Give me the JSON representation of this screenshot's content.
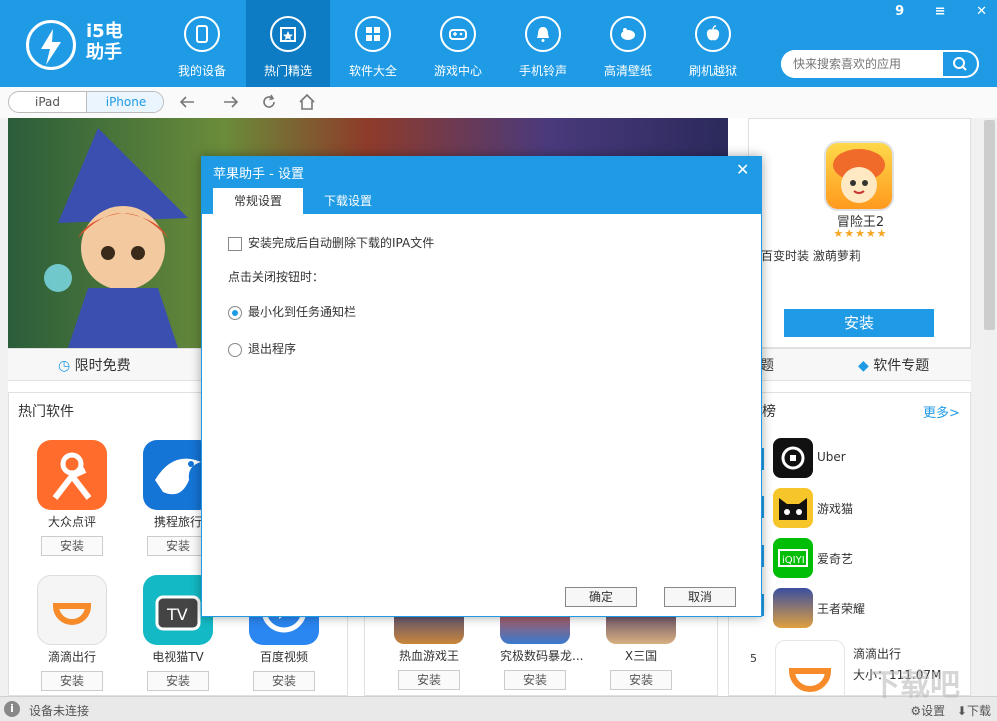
{
  "app": {
    "brand": "i5电\n助手"
  },
  "nav": [
    {
      "label": "我的设备",
      "icon": "phone-icon"
    },
    {
      "label": "热门精选",
      "icon": "star-calendar-icon"
    },
    {
      "label": "软件大全",
      "icon": "grid-icon"
    },
    {
      "label": "游戏中心",
      "icon": "gamepad-icon"
    },
    {
      "label": "手机铃声",
      "icon": "bell-icon"
    },
    {
      "label": "高清壁纸",
      "icon": "wallpaper-icon"
    },
    {
      "label": "刷机越狱",
      "icon": "apple-icon"
    }
  ],
  "window": {
    "badge": "9",
    "menu": "≡",
    "close": "✕"
  },
  "search": {
    "placeholder": "快来搜索喜欢的应用"
  },
  "device_toggle": {
    "ipad": "iPad",
    "iphone": "iPhone",
    "selected": "iPhone"
  },
  "featured": {
    "name": "冒险王2",
    "stars": "★★★★★",
    "desc": "百变时装 激萌萝莉",
    "install": "安装"
  },
  "tabs": {
    "free": "限时免费",
    "topic": "软件专题",
    "frag": "题"
  },
  "hot": {
    "title": "热门软件",
    "apps": [
      {
        "name": "大众点评",
        "install": "安装"
      },
      {
        "name": "携程旅行",
        "install": "安装"
      },
      {
        "name": "滴滴出行",
        "install": "安装"
      },
      {
        "name": "电视猫TV",
        "install": "安装"
      },
      {
        "name": "百度视频",
        "install": "安装"
      }
    ]
  },
  "games": [
    {
      "name": "热血游戏王",
      "install": "安装"
    },
    {
      "name": "究极数码暴龙...",
      "install": "安装"
    },
    {
      "name": "X三国",
      "install": "安装"
    }
  ],
  "rank": {
    "title": "榜",
    "more": "更多>",
    "items": [
      {
        "name": "Uber"
      },
      {
        "name": "游戏猫"
      },
      {
        "name": "爱奇艺"
      },
      {
        "name": "王者荣耀"
      }
    ],
    "fifth": {
      "num": "5",
      "name": "滴滴出行",
      "size": "大小：111.07M"
    }
  },
  "status": {
    "text": "设备未连接",
    "settings": "设置",
    "download": "下载"
  },
  "dialog": {
    "title": "苹果助手 - 设置",
    "tab_general": "常规设置",
    "tab_download": "下载设置",
    "opt_delete": "安装完成后自动删除下载的IPA文件",
    "close_label": "点击关闭按钮时：",
    "radio_minimize": "最小化到任务通知栏",
    "radio_exit": "退出程序",
    "ok": "确定",
    "cancel": "取消"
  },
  "watermark": "下载吧"
}
